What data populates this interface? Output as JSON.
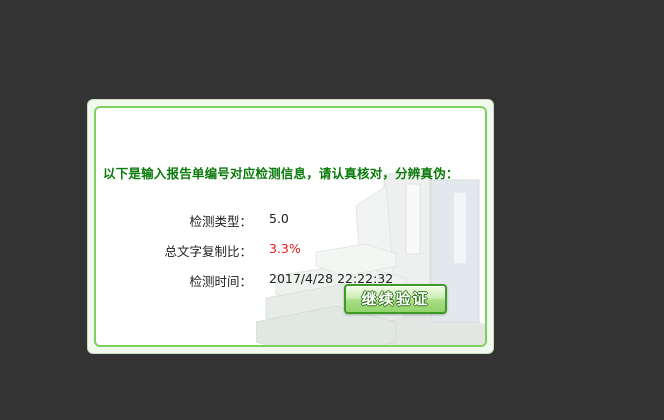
{
  "dialog": {
    "headline": "以下是输入报告单编号对应检测信息，请认真核对，分辨真伪：",
    "rows": [
      {
        "label": "检测类型：",
        "value": "5.0"
      },
      {
        "label": "总文字复制比：",
        "value": "3.3%"
      },
      {
        "label": "检测时间：",
        "value": "2017/4/28 22:22:32"
      }
    ],
    "continue_button": "继续验证"
  },
  "colors": {
    "page_background": "#333333",
    "headline": "#0a7a0a",
    "highlight_value": "#e51c1c",
    "frame_border": "#7fd15e",
    "button_green": "#92d46c"
  },
  "icons": {
    "background": "binders-illustration"
  }
}
